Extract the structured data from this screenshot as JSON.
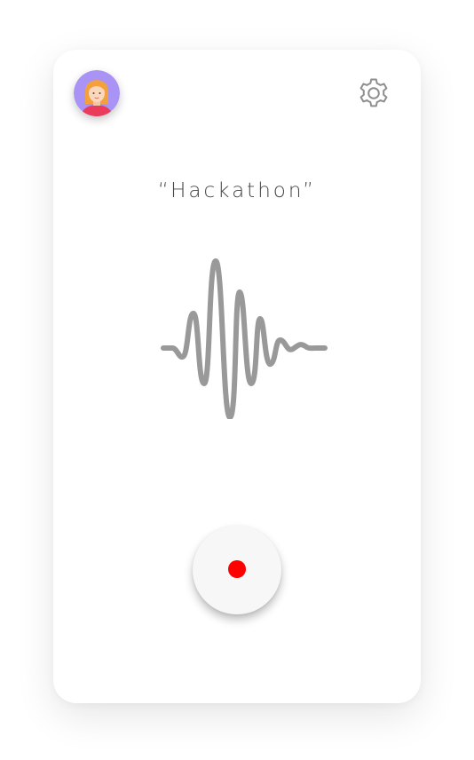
{
  "phrase": {
    "text": "“Hackathon”"
  },
  "header": {
    "avatar_icon": "user-avatar-icon",
    "settings_icon": "gear-icon"
  },
  "waveform": {
    "icon": "sound-wave-icon",
    "color": "#999999"
  },
  "record": {
    "icon": "record-dot-icon",
    "dot_color": "#ff0000"
  },
  "colors": {
    "avatar_bg": "#a993f4",
    "avatar_hair": "#f4a13d",
    "avatar_shirt": "#ea3b5a",
    "gear": "#8e8e8e"
  }
}
